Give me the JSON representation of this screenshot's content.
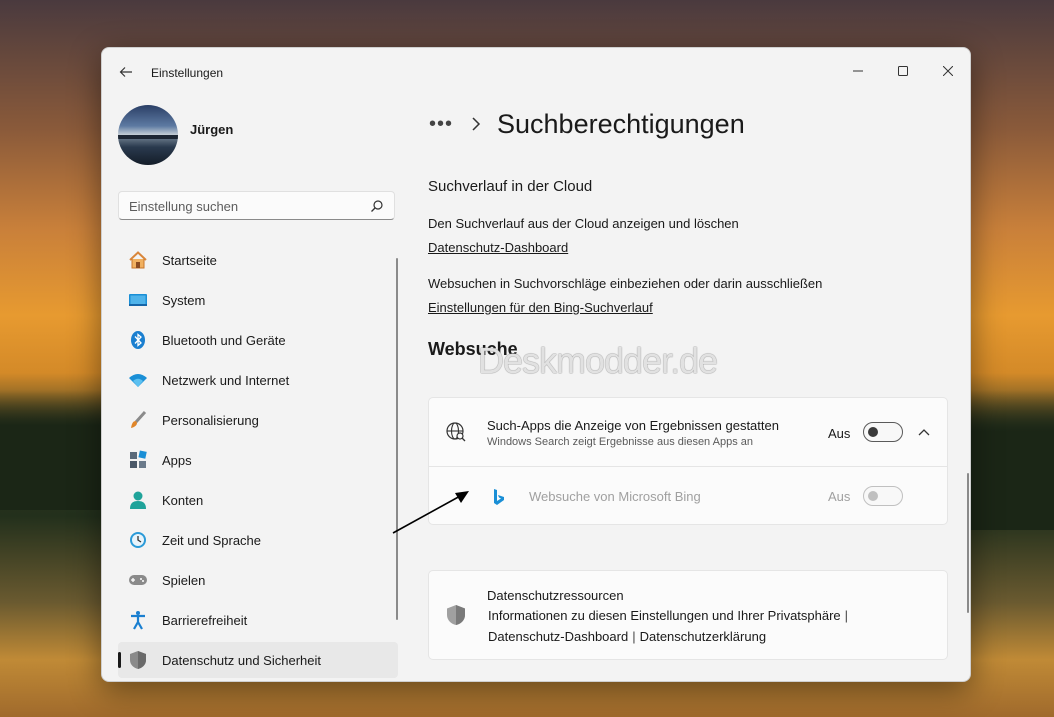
{
  "window": {
    "title": "Einstellungen"
  },
  "user": {
    "name": "Jürgen"
  },
  "search": {
    "placeholder": "Einstellung suchen"
  },
  "sidebar": {
    "items": [
      {
        "label": "Startseite",
        "icon": "home-icon"
      },
      {
        "label": "System",
        "icon": "system-icon"
      },
      {
        "label": "Bluetooth und Geräte",
        "icon": "bluetooth-icon"
      },
      {
        "label": "Netzwerk und Internet",
        "icon": "wifi-icon"
      },
      {
        "label": "Personalisierung",
        "icon": "brush-icon"
      },
      {
        "label": "Apps",
        "icon": "apps-icon"
      },
      {
        "label": "Konten",
        "icon": "account-icon"
      },
      {
        "label": "Zeit und Sprache",
        "icon": "clock-globe-icon"
      },
      {
        "label": "Spielen",
        "icon": "gamepad-icon"
      },
      {
        "label": "Barrierefreiheit",
        "icon": "accessibility-icon"
      },
      {
        "label": "Datenschutz und Sicherheit",
        "icon": "shield-icon",
        "active": true
      }
    ]
  },
  "main": {
    "breadcrumb_more": "•••",
    "title": "Suchberechtigungen",
    "cloud": {
      "title": "Suchverlauf in der Cloud",
      "text1": "Den Suchverlauf aus der Cloud anzeigen und löschen",
      "link1": "Datenschutz-Dashboard",
      "text2": "Websuchen in Suchvorschläge einbeziehen oder darin ausschließen",
      "link2": "Einstellungen für den Bing-Suchverlauf"
    },
    "websearch": {
      "heading": "Websuche",
      "watermark": "Deskmodder.de",
      "row1": {
        "title": "Such-Apps die Anzeige von Ergebnissen gestatten",
        "desc": "Windows Search zeigt Ergebnisse aus diesen Apps an",
        "state": "Aus"
      },
      "row2": {
        "title": "Websuche von Microsoft Bing",
        "state": "Aus"
      }
    },
    "privacy": {
      "title": "Datenschutzressourcen",
      "line1": "Informationen zu diesen Einstellungen und Ihrer Privatsphäre",
      "link_dashboard": "Datenschutz-Dashboard",
      "link_statement": "Datenschutzerklärung",
      "separator": "|"
    }
  },
  "colors": {
    "accent": "#0067c0",
    "bing": "#1a8fd6"
  }
}
